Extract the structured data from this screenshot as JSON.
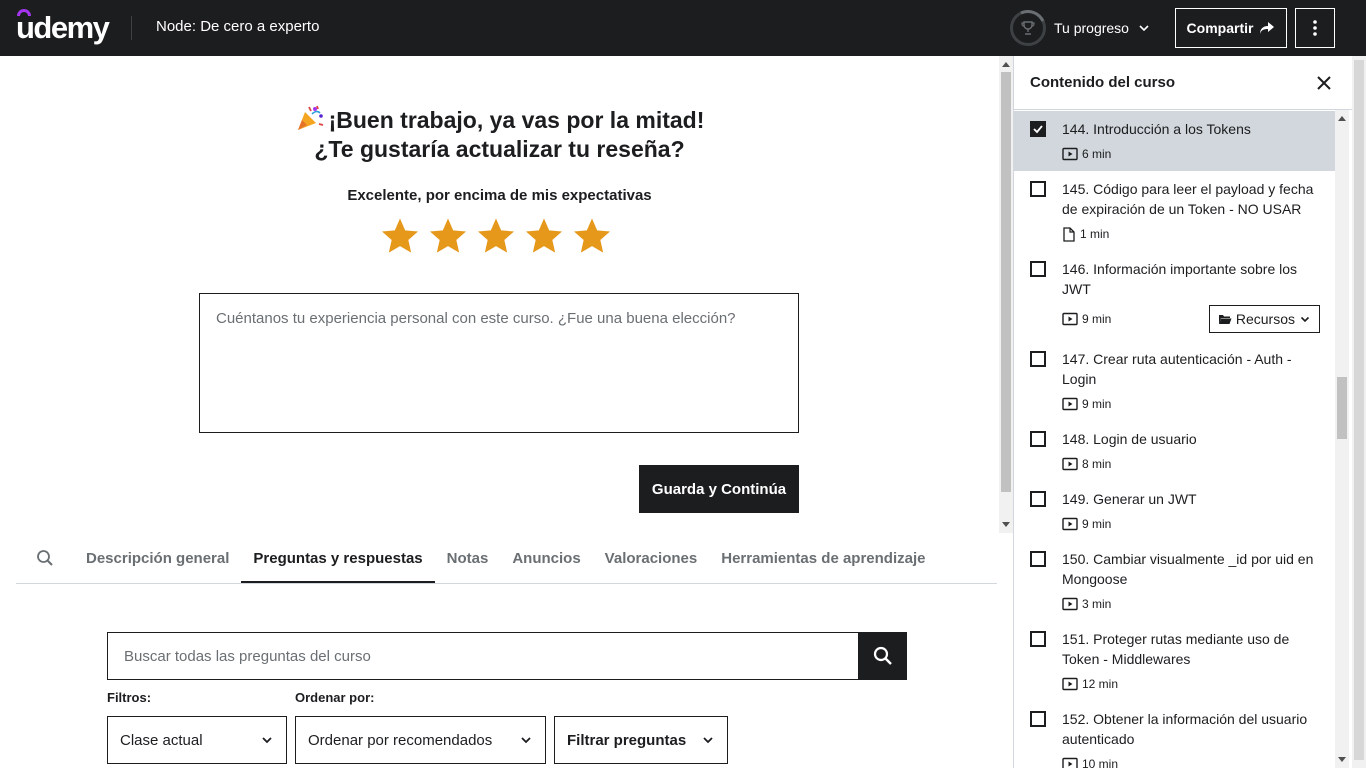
{
  "header": {
    "logo": "udemy",
    "course_title": "Node: De cero a experto",
    "progress_label": "Tu progreso",
    "share_label": "Compartir"
  },
  "review": {
    "title_line1": "¡Buen trabajo, ya vas por la mitad!",
    "title_line2": "¿Te gustaría actualizar tu reseña?",
    "rating_label": "Excelente, por encima de mis expectativas",
    "rating": 5,
    "textarea_placeholder": "Cuéntanos tu experiencia personal con este curso. ¿Fue una buena elección?",
    "save_label": "Guarda y Continúa",
    "star_color": "#e59819"
  },
  "tabs": [
    {
      "label": "Descripción general",
      "active": false
    },
    {
      "label": "Preguntas y respuestas",
      "active": true
    },
    {
      "label": "Notas",
      "active": false
    },
    {
      "label": "Anuncios",
      "active": false
    },
    {
      "label": "Valoraciones",
      "active": false
    },
    {
      "label": "Herramientas de aprendizaje",
      "active": false
    }
  ],
  "qa": {
    "search_placeholder": "Buscar todas las preguntas del curso",
    "filters_label": "Filtros:",
    "sort_label": "Ordenar por:",
    "filter_value": "Clase actual",
    "sort_value": "Ordenar por recomendados",
    "filter_questions_label": "Filtrar preguntas"
  },
  "sidebar": {
    "title": "Contenido del curso",
    "lectures": [
      {
        "title": "144. Introducción a los Tokens",
        "duration": "6 min",
        "type": "video",
        "checked": true,
        "active": true,
        "resources": false
      },
      {
        "title": "145. Código para leer el payload y fecha de expiración de un Token - NO USAR",
        "duration": "1 min",
        "type": "document",
        "checked": false,
        "active": false,
        "resources": false
      },
      {
        "title": "146. Información importante sobre los JWT",
        "duration": "9 min",
        "type": "video",
        "checked": false,
        "active": false,
        "resources": true
      },
      {
        "title": "147. Crear ruta autenticación - Auth - Login",
        "duration": "9 min",
        "type": "video",
        "checked": false,
        "active": false,
        "resources": false
      },
      {
        "title": "148. Login de usuario",
        "duration": "8 min",
        "type": "video",
        "checked": false,
        "active": false,
        "resources": false
      },
      {
        "title": "149. Generar un JWT",
        "duration": "9 min",
        "type": "video",
        "checked": false,
        "active": false,
        "resources": false
      },
      {
        "title": "150. Cambiar visualmente _id por uid en Mongoose",
        "duration": "3 min",
        "type": "video",
        "checked": false,
        "active": false,
        "resources": false
      },
      {
        "title": "151. Proteger rutas mediante uso de Token - Middlewares",
        "duration": "12 min",
        "type": "video",
        "checked": false,
        "active": false,
        "resources": false
      },
      {
        "title": "152. Obtener la información del usuario autenticado",
        "duration": "10 min",
        "type": "video",
        "checked": false,
        "active": false,
        "resources": false
      }
    ],
    "resources_label": "Recursos"
  }
}
